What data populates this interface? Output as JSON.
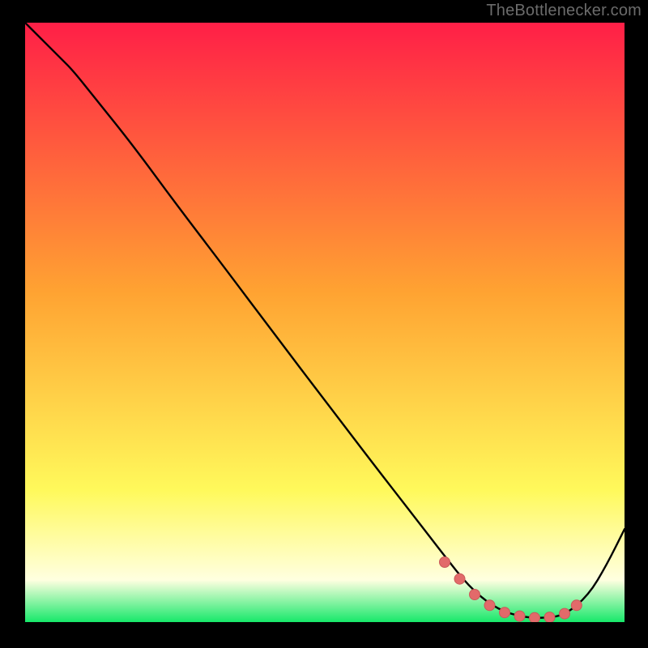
{
  "watermark": "TheBottlenecker.com",
  "colors": {
    "gradient_top": "#ff1f47",
    "gradient_mid": "#ffa332",
    "gradient_low": "#fff95b",
    "gradient_pale": "#ffffe0",
    "gradient_bottom": "#17e86a",
    "curve": "#000000",
    "marker_fill": "#e26a6a",
    "marker_stroke": "#c95a5a",
    "frame": "#000000"
  },
  "chart_data": {
    "type": "line",
    "title": "",
    "xlabel": "",
    "ylabel": "",
    "xlim": [
      0,
      100
    ],
    "ylim": [
      0,
      100
    ],
    "grid": false,
    "series": [
      {
        "name": "bottleneck-curve",
        "x": [
          0,
          3,
          6,
          8,
          12,
          18,
          25,
          33,
          42,
          50,
          58,
          65,
          70,
          74,
          78,
          82,
          86,
          90,
          94,
          97,
          100
        ],
        "y": [
          100,
          97,
          94,
          92,
          87,
          79.5,
          70,
          59.5,
          47.5,
          37,
          26.5,
          17.5,
          11,
          6,
          2.6,
          1,
          0.6,
          1.1,
          4.5,
          9.5,
          15.5
        ]
      }
    ],
    "markers": {
      "name": "highlight-dots",
      "x": [
        70,
        72.5,
        75,
        77.5,
        80,
        82.5,
        85,
        87.5,
        90,
        92
      ],
      "y": [
        10,
        7.2,
        4.6,
        2.8,
        1.6,
        1.0,
        0.7,
        0.8,
        1.4,
        2.8
      ]
    }
  }
}
